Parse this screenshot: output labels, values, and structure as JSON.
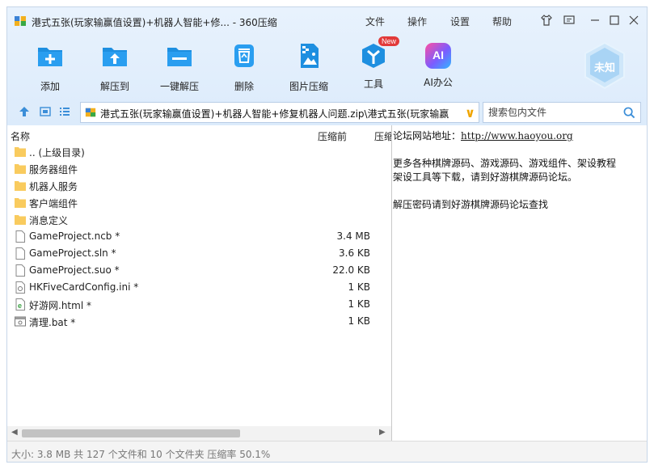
{
  "titlebar": {
    "title": "港式五张(玩家输赢值设置)+机器人智能+修... - 360压缩",
    "menus": [
      "文件",
      "操作",
      "设置",
      "帮助"
    ]
  },
  "toolbar": {
    "add": "添加",
    "extract_to": "解压到",
    "one_click_extract": "一键解压",
    "delete": "删除",
    "image_compress": "图片压缩",
    "tools": "工具",
    "tools_badge": "New",
    "ai_office": "AI办公",
    "ai_icon_text": "AI",
    "unknown_badge": "未知"
  },
  "address": {
    "path": "港式五张(玩家输赢值设置)+机器人智能+修复机器人问题.zip\\港式五张(玩家输赢",
    "search_placeholder": "搜索包内文件"
  },
  "list": {
    "col_name": "名称",
    "col_before": "压缩前",
    "col_after": "压缩",
    "rows": [
      {
        "name": ".. (上级目录)",
        "size": "",
        "icon": "folder-icon"
      },
      {
        "name": "服务器组件",
        "size": "",
        "icon": "folder-icon"
      },
      {
        "name": "机器人服务",
        "size": "",
        "icon": "folder-icon"
      },
      {
        "name": "客户端组件",
        "size": "",
        "icon": "folder-icon"
      },
      {
        "name": "消息定义",
        "size": "",
        "icon": "folder-icon"
      },
      {
        "name": "GameProject.ncb *",
        "size": "3.4 MB",
        "icon": "file-icon"
      },
      {
        "name": "GameProject.sln *",
        "size": "3.6 KB",
        "icon": "file-icon"
      },
      {
        "name": "GameProject.suo *",
        "size": "22.0 KB",
        "icon": "file-icon"
      },
      {
        "name": "HKFiveCardConfig.ini *",
        "size": "1 KB",
        "icon": "ini-icon"
      },
      {
        "name": "好游网.html *",
        "size": "1 KB",
        "icon": "html-icon"
      },
      {
        "name": "清理.bat *",
        "size": "1 KB",
        "icon": "bat-icon"
      }
    ]
  },
  "comment": {
    "line1_label": "论坛网站地址：",
    "line1_link": "http://www.haoyou.org",
    "line2": "更多各种棋牌源码、游戏源码、游戏组件、架设教程",
    "line3": "架设工具等下载，请到好游棋牌源码论坛。",
    "line4": "解压密码请到好游棋牌源码论坛查找"
  },
  "status": {
    "text": "大小: 3.8 MB 共 127 个文件和 10 个文件夹 压缩率 50.1%"
  },
  "colors": {
    "accent_blue": "#1e8fe0",
    "toolbar_bg": "#e3effc"
  }
}
